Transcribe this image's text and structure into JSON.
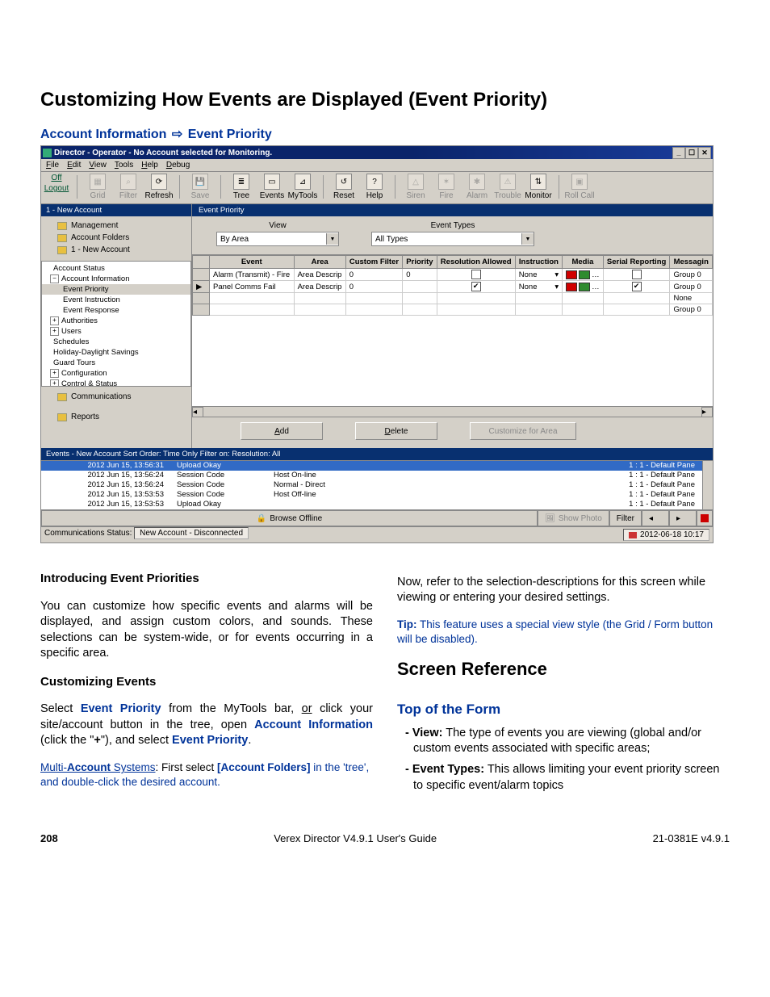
{
  "page_title": "Customizing How Events are Displayed (Event Priority)",
  "breadcrumb": {
    "a": "Account Information",
    "b": "Event Priority"
  },
  "titlebar": "Director - Operator - No Account selected for Monitoring.",
  "winctrl": {
    "min": "_",
    "max": "☐",
    "close": "✕"
  },
  "menus": {
    "file": "File",
    "edit": "Edit",
    "view": "View",
    "tools": "Tools",
    "help": "Help",
    "debug": "Debug"
  },
  "toolbar": {
    "off": "Off",
    "logout": "Logout",
    "grid": "Grid",
    "filter": "Filter",
    "refresh": "Refresh",
    "save": "Save",
    "tree": "Tree",
    "events": "Events",
    "mytools": "MyTools",
    "reset": "Reset",
    "help": "Help",
    "siren": "Siren",
    "fire": "Fire",
    "alarm": "Alarm",
    "trouble": "Trouble",
    "monitor": "Monitor",
    "rollcall": "Roll Call"
  },
  "tree": {
    "header": "1 - New Account",
    "management": "Management",
    "account_folders": "Account Folders",
    "new_account": "1 - New Account",
    "nodes": {
      "account_status": "Account Status",
      "account_information": "Account Information",
      "event_priority": "Event Priority",
      "event_instruction": "Event Instruction",
      "event_response": "Event Response",
      "authorities": "Authorities",
      "users": "Users",
      "schedules": "Schedules",
      "holiday": "Holiday-Daylight Savings",
      "guard_tours": "Guard Tours",
      "configuration": "Configuration",
      "control_status": "Control & Status"
    },
    "communications": "Communications",
    "reports": "Reports"
  },
  "section_header": "Event Priority",
  "view": {
    "view_label": "View",
    "view_value": "By Area",
    "types_label": "Event Types",
    "types_value": "All Types"
  },
  "grid": {
    "cols": {
      "event": "Event",
      "area": "Area",
      "custom_filter": "Custom Filter",
      "priority": "Priority",
      "resolution_allowed": "Resolution Allowed",
      "instruction": "Instruction",
      "media": "Media",
      "serial_reporting": "Serial Reporting",
      "messaging": "Messagin"
    },
    "rows": [
      {
        "event": "Alarm (Transmit) - Fire",
        "area": "Area Descrip",
        "cf": "0",
        "prio": "0",
        "resolved": false,
        "instr": "None",
        "serial": false,
        "msg": "Group 0",
        "c1": "#D00000",
        "c2": "#2E8B2E"
      },
      {
        "event": "Panel Comms Fail",
        "area": "Area Descrip",
        "cf": "0",
        "prio": "",
        "resolved": true,
        "instr": "None",
        "serial": true,
        "msg": "Group 0",
        "c1": "#D00000",
        "c2": "#2E8B2E"
      }
    ],
    "extra_msg": [
      "None",
      "Group 0"
    ]
  },
  "buttons": {
    "add": "Add",
    "delete": "Delete",
    "customize": "Customize for Area"
  },
  "events_header": "Events - New Account Sort Order: Time Only  Filter on:  Resolution: All",
  "events": [
    {
      "t": "2012 Jun 15, 13:56:31",
      "a": "Upload Okay",
      "b": "",
      "c": "1 : 1 - Default Pane",
      "sel": true
    },
    {
      "t": "2012 Jun 15, 13:56:24",
      "a": "Session Code",
      "b": "Host On-line",
      "c": "1 : 1 - Default Pane",
      "sel": false
    },
    {
      "t": "2012 Jun 15, 13:56:24",
      "a": "Session Code",
      "b": "Normal - Direct",
      "c": "1 : 1 - Default Pane",
      "sel": false
    },
    {
      "t": "2012 Jun 15, 13:53:53",
      "a": "Session Code",
      "b": "Host Off-line",
      "c": "1 : 1 - Default Pane",
      "sel": false
    },
    {
      "t": "2012 Jun 15, 13:53:53",
      "a": "Upload Okay",
      "b": "",
      "c": "1 : 1 - Default Pane",
      "sel": false
    }
  ],
  "browse": {
    "offline": "Browse Offline",
    "showphoto": "Show Photo",
    "filter": "Filter"
  },
  "status": {
    "label": "Communications Status:",
    "value": "New Account - Disconnected",
    "datetime": "2012-06-18 10:17"
  },
  "article": {
    "h_intro": "Introducing Event Priorities",
    "p_intro": "You can customize how specific events and alarms will be displayed, and assign custom colors, and sounds.  These selections can be system-wide, or for events occurring in a specific area.",
    "h_customize": "Customizing Events",
    "p_custom_a": "Select ",
    "p_custom_b": "Event Priority",
    "p_custom_c": " from the MyTools bar, ",
    "p_custom_or": "or",
    "p_custom_d": " click your site/account button in the tree, open ",
    "p_custom_e": "Account Information",
    "p_custom_f": " (click the \"",
    "p_custom_plus": "+",
    "p_custom_g": "\"), and select ",
    "p_custom_h": "Event Priority",
    "p_custom_i": ".",
    "multi_a": "Multi-",
    "multi_b": "Account",
    "multi_c": " Systems",
    "multi_d": ":  First select ",
    "multi_e": "[Account Folders]",
    "multi_f": " in the 'tree', and double-click the desired account.",
    "p_now": "Now, refer to the selection-descriptions for this screen while viewing or entering your desired settings.",
    "tip_l": "Tip:",
    "tip_t": "  This feature uses a special view style (the Grid / Form button will be disabled).",
    "h_screenref": "Screen Reference",
    "h_topform": "Top of the Form",
    "li1_a": "View:",
    "li1_b": " The type of events you are viewing (global and/or custom events associated with specific areas;",
    "li2_a": "Event Types:",
    "li2_b": " This allows limiting your event priority screen to specific event/alarm topics"
  },
  "footer": {
    "page": "208",
    "guide": "Verex Director V4.9.1 User's Guide",
    "doc": "21-0381E v4.9.1"
  }
}
